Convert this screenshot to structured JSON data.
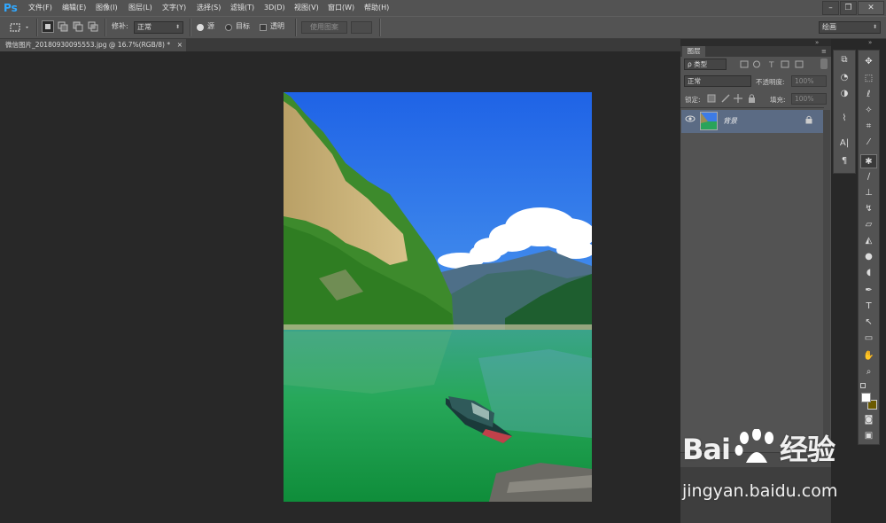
{
  "app": {
    "logo": "Ps"
  },
  "menu": [
    "文件(F)",
    "编辑(E)",
    "图像(I)",
    "图层(L)",
    "文字(Y)",
    "选择(S)",
    "滤镜(T)",
    "3D(D)",
    "视图(V)",
    "窗口(W)",
    "帮助(H)"
  ],
  "window_controls": {
    "minimize": "–",
    "restore": "❐",
    "close": "✕"
  },
  "options": {
    "repair_label": "修补:",
    "repair_mode": "正常",
    "source_label": "源",
    "target_label": "目标",
    "transparent_label": "透明",
    "use_pattern": "使用图案",
    "workspace": "绘画"
  },
  "document_tab": {
    "title": "微信图片_20180930095553.jpg @ 16.7%(RGB/8) *",
    "close": "×"
  },
  "layers_panel": {
    "tab": "图层",
    "filter_kind": "ρ 类型",
    "blend_mode": "正常",
    "opacity_label": "不透明度:",
    "opacity_value": "100%",
    "lock_label": "锁定:",
    "fill_label": "填充:",
    "fill_value": "100%",
    "layer_name": "背景"
  },
  "icons": {
    "eye": "eye-icon",
    "lock": "lock-icon",
    "tools": [
      "move-tool-icon",
      "marquee-tool-icon",
      "lasso-tool-icon",
      "magic-wand-icon",
      "crop-tool-icon",
      "eyedropper-icon",
      "patch-tool-icon",
      "brush-tool-icon",
      "stamp-tool-icon",
      "history-brush-icon",
      "eraser-icon",
      "paint-bucket-icon",
      "blur-tool-icon",
      "dodge-tool-icon",
      "pen-tool-icon",
      "type-tool-icon",
      "path-select-icon",
      "shape-tool-icon",
      "hand-tool-icon",
      "zoom-tool-icon"
    ]
  },
  "colors": {
    "foreground": "#ffffff",
    "background": "#6b5a00",
    "layer_selected": "#5b6b84"
  },
  "watermark": {
    "logo_text_left": "Bai",
    "logo_text_right": "经验",
    "url": "jingyan.baidu.com"
  }
}
